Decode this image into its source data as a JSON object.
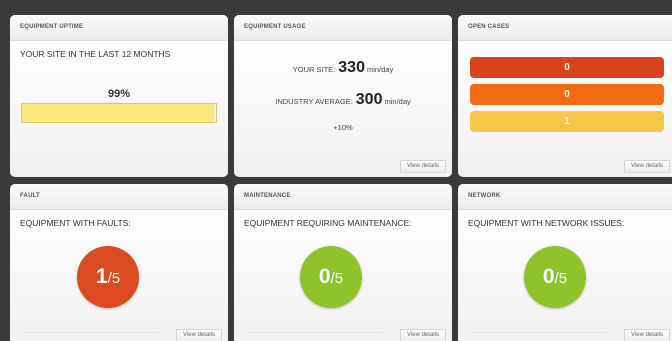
{
  "uptime": {
    "header": "EQUIPMENT UPTIME",
    "subtitle": "YOUR SITE IN THE LAST 12 MONTHS",
    "percent_label": "99%",
    "percent_value": 0.99,
    "bar_color": "#fbe77a"
  },
  "usage": {
    "header": "EQUIPMENT USAGE",
    "site_label": "YOUR SITE:",
    "site_value": "330",
    "site_unit": "min/day",
    "industry_label": "INDUSTRY AVERAGE:",
    "industry_value": "300",
    "industry_unit": "min/day",
    "delta": "+10%",
    "view_details": "View details"
  },
  "open_cases": {
    "header": "OPEN CASES",
    "bars": [
      {
        "value": "0",
        "color": "#d9421a"
      },
      {
        "value": "0",
        "color": "#f26a12"
      },
      {
        "value": "1",
        "color": "#f6c648"
      }
    ],
    "view_details": "View details"
  },
  "fault": {
    "header": "FAULT",
    "subtitle": "EQUIPMENT WITH FAULTS:",
    "count": "1",
    "total": "/5",
    "color": "#dc4a22",
    "view_details": "View details"
  },
  "maintenance": {
    "header": "MAINTENANCE",
    "subtitle": "EQUIPMENT REQUIRING MAINTENANCE:",
    "count": "0",
    "total": "/5",
    "color": "#8cc42a",
    "view_details": "View details"
  },
  "network": {
    "header": "NETWORK",
    "subtitle": "EQUIPMENT WITH NETWORK ISSUES:",
    "count": "0",
    "total": "/5",
    "color": "#8cc42a",
    "view_details": "View details"
  }
}
